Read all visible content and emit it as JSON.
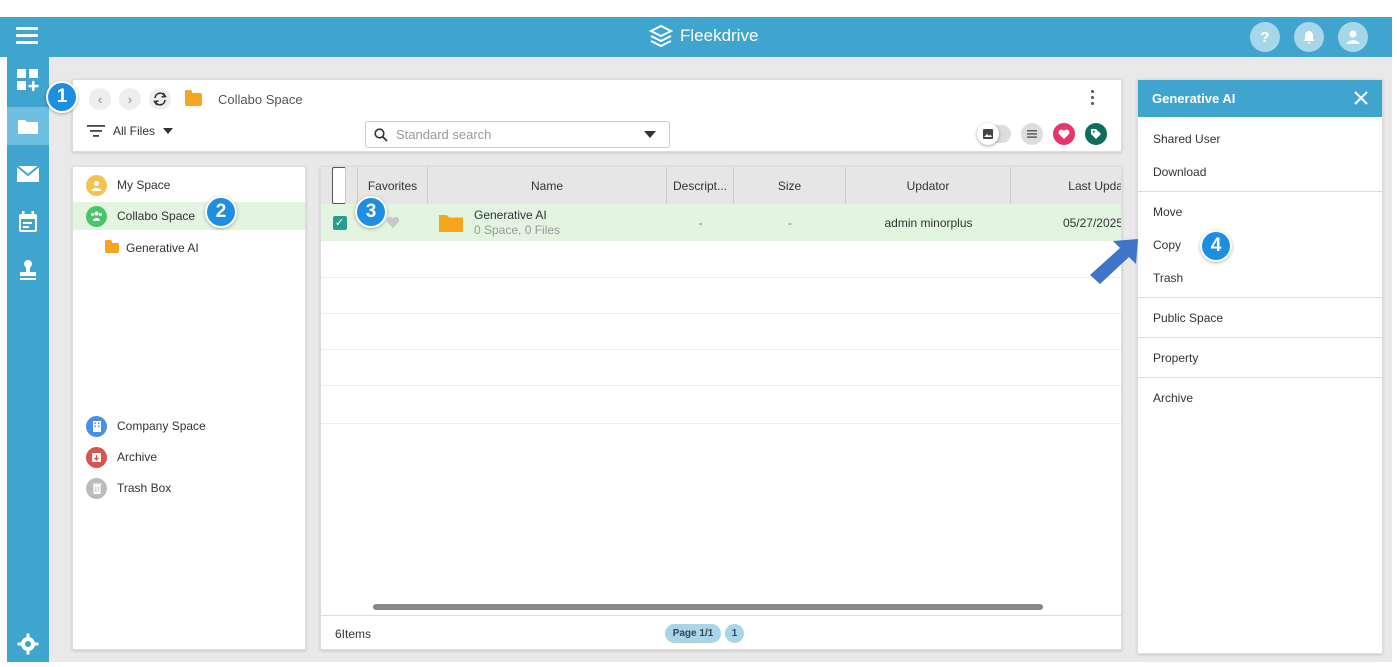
{
  "app": {
    "brand": "Fleekdrive"
  },
  "header": {
    "help_icon": "question-icon",
    "notifications_icon": "bell-icon",
    "account_icon": "user-icon"
  },
  "breadcrumb": {
    "current": "Collabo Space"
  },
  "filter": {
    "label": "All Files"
  },
  "search": {
    "placeholder": "Standard search",
    "value": ""
  },
  "tree": {
    "items": [
      {
        "label": "My Space",
        "color": "#f5c24f"
      },
      {
        "label": "Collabo Space",
        "color": "#4cc36a"
      },
      {
        "label": "Generative AI",
        "color": "#f7a51e"
      }
    ],
    "bottom_items": [
      {
        "label": "Company Space",
        "color": "#4a90e2"
      },
      {
        "label": "Archive",
        "color": "#d9534f"
      },
      {
        "label": "Trash Box",
        "color": "#bbbbbb"
      }
    ]
  },
  "table": {
    "columns": [
      "Favorites",
      "Name",
      "Descript...",
      "Size",
      "Updator",
      "Last Upda"
    ],
    "rows": [
      {
        "name": "Generative AI",
        "sub": "0 Space, 0 Files",
        "description": "-",
        "size": "-",
        "updator": "admin minorplus",
        "last_updated": "05/27/2025",
        "checked": true
      }
    ]
  },
  "footer": {
    "count": "6Items",
    "page": "Page 1/1",
    "page_num": "1"
  },
  "context_menu": {
    "title": "Generative AI",
    "groups": [
      [
        "Shared User",
        "Download"
      ],
      [
        "Move",
        "Copy",
        "Trash"
      ],
      [
        "Public Space"
      ],
      [
        "Property"
      ],
      [
        "Archive"
      ]
    ]
  },
  "badges": [
    "1",
    "2",
    "3",
    "4"
  ],
  "colors": {
    "accent": "#3fa5cf",
    "selected_row": "#e3f4e1",
    "badge": "#1e8fe0",
    "arrow": "#3f74c8"
  }
}
